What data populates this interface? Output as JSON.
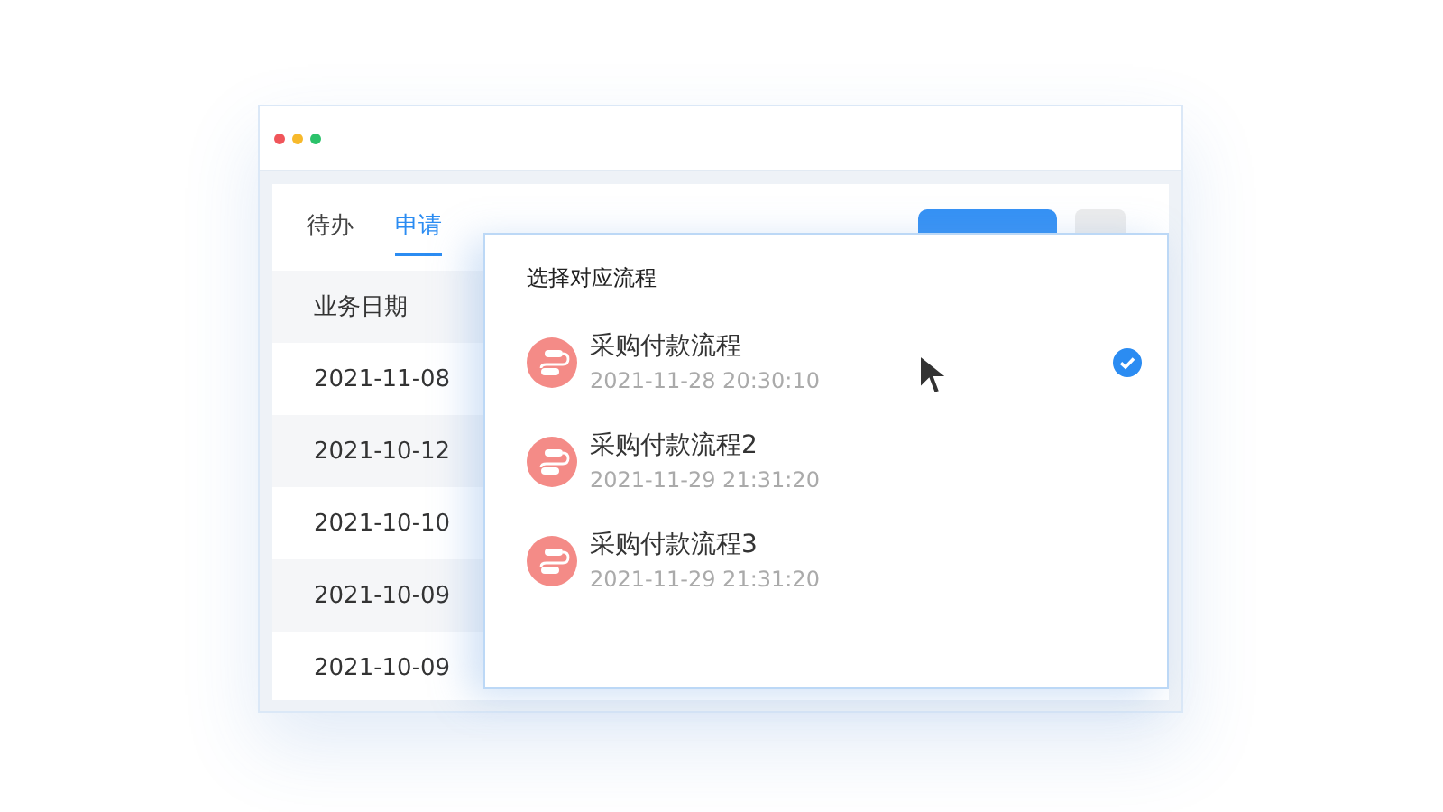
{
  "window": {
    "dots": [
      {
        "color": "#f0555a"
      },
      {
        "color": "#f7b92b"
      },
      {
        "color": "#2bc26a"
      }
    ]
  },
  "tabs": [
    {
      "label": "待办",
      "selected": false
    },
    {
      "label": "申请",
      "selected": true
    }
  ],
  "table": {
    "columns": [
      "业务日期"
    ],
    "rows": [
      "2021-11-08",
      "2021-10-12",
      "2021-10-10",
      "2021-10-09",
      "2021-10-09"
    ]
  },
  "popup": {
    "title": "选择对应流程",
    "items": [
      {
        "name": "采购付款流程",
        "time": "2021-11-28 20:30:10",
        "selected": true
      },
      {
        "name": "采购付款流程2",
        "time": "2021-11-29 21:31:20",
        "selected": false
      },
      {
        "name": "采购付款流程3",
        "time": "2021-11-29 21:31:20",
        "selected": false
      }
    ]
  }
}
